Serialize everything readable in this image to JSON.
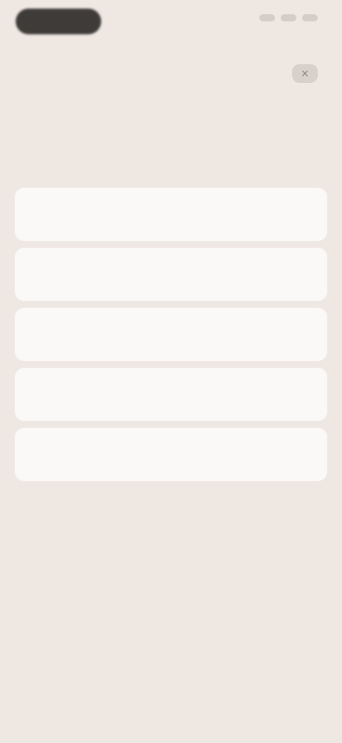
{
  "dialog": {
    "close_label": "×",
    "title_line1": "",
    "title_line2": ""
  },
  "options": [
    {
      "label": ""
    },
    {
      "label": ""
    },
    {
      "label": ""
    },
    {
      "label": ""
    },
    {
      "label": ""
    }
  ],
  "colors": {
    "background": "#efe7e1",
    "card": "#fbf9f7",
    "pill": "#3e3b39"
  }
}
